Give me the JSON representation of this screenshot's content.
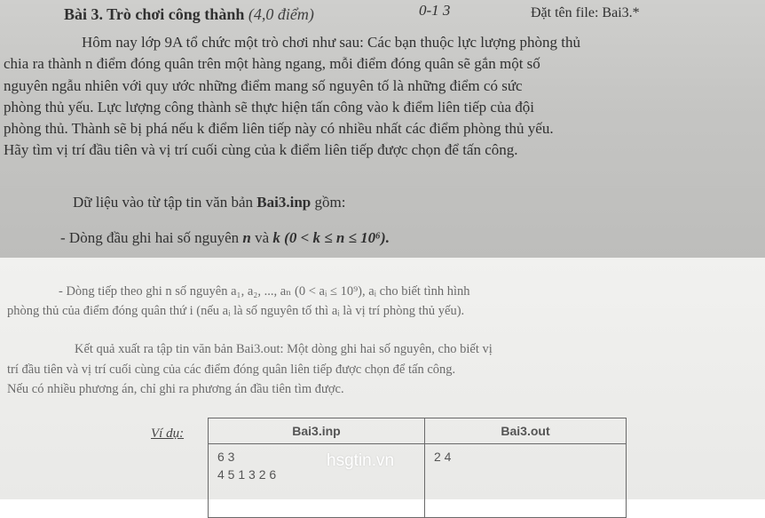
{
  "title": "Bài 3. Trò chơi công thành",
  "score": "(4,0 điểm)",
  "handwritten_note": "0-1 3",
  "filename_label": "Đặt tên file: Bai3.*",
  "paragraph1": [
    "Hôm nay lớp 9A tổ chức một trò chơi như sau: Các bạn thuộc lực lượng phòng thủ",
    "chia ra thành n điểm đóng quân trên một hàng ngang, mỗi điểm đóng quân sẽ gắn một số",
    "nguyên ngẫu nhiên với quy ước những điểm mang số nguyên tố là những điểm có sức",
    "phòng thủ yếu. Lực lượng công thành sẽ thực hiện tấn công vào k điểm liên tiếp của đội",
    "phòng thủ. Thành sẽ bị phá nếu k điểm liên tiếp này có nhiều nhất các điểm phòng thủ yếu.",
    "Hãy tìm vị trí đầu tiên và vị trí cuối cùng của k điểm liên tiếp được chọn để tấn công."
  ],
  "input_intro_pre": "Dữ liệu vào từ tập tin văn bản ",
  "input_file": "Bai3.inp",
  "input_intro_post": " gồm:",
  "input_line1_pre": "- Dòng đầu ghi hai số nguyên ",
  "input_line1_vars": "n",
  "input_line1_mid": " và ",
  "input_line1_k": "k",
  "input_line1_cond": "(0 < k ≤ n ≤ 10⁶).",
  "input_line2": [
    "- Dòng tiếp theo ghi n số nguyên a₁, a₂, ..., aₙ (0 < aᵢ ≤ 10⁹), aᵢ cho biết tình hình",
    "phòng thủ của điểm đóng quân thứ i (nếu aᵢ là số nguyên tố thì aᵢ là vị trí phòng thủ yếu)."
  ],
  "output_para": [
    "Kết quả xuất ra tập tin văn bản Bai3.out: Một dòng ghi hai số nguyên, cho biết vị",
    "trí đầu tiên và vị trí cuối cùng của các điểm đóng quân liên tiếp được chọn để tấn công.",
    "Nếu có nhiều phương án, chỉ ghi ra phương án đầu tiên tìm được."
  ],
  "example_label": "Ví dụ:",
  "example": {
    "headers": [
      "Bai3.inp",
      "Bai3.out"
    ],
    "inp_lines": [
      "6 3",
      "4 5 1 3 2 6"
    ],
    "out_lines": [
      "2 4"
    ]
  },
  "watermark": "hsgtin.vn"
}
